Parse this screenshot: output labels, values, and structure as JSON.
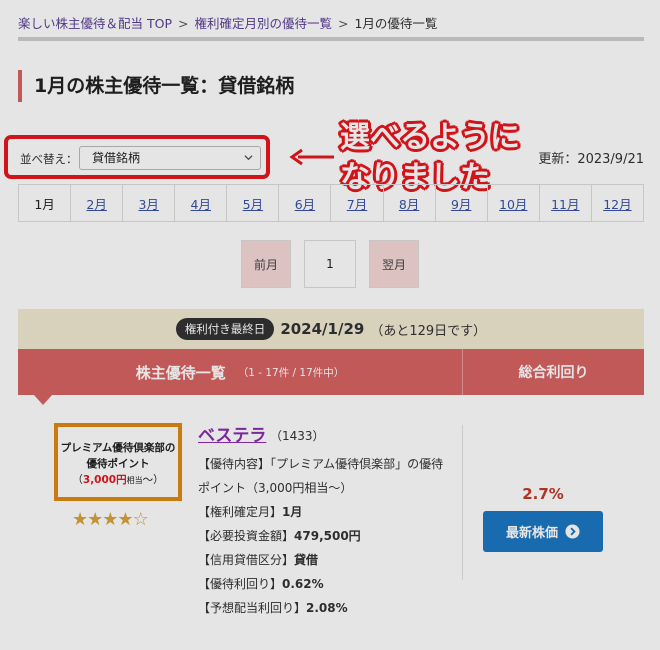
{
  "breadcrumb": {
    "items": [
      "楽しい株主優待＆配当 TOP",
      "権利確定月別の優待一覧",
      "1月の優待一覧"
    ],
    "separator": ">"
  },
  "page_title": "1月の株主優待一覧：貸借銘柄",
  "sort": {
    "label": "並べ替え：",
    "selected": "貸借銘柄"
  },
  "updated_text": "更新：2023/9/21",
  "callout": {
    "line1": "選べるように",
    "line2": "なりました",
    "color": "#e8171d"
  },
  "months": [
    "1月",
    "2月",
    "3月",
    "4月",
    "5月",
    "6月",
    "7月",
    "8月",
    "9月",
    "10月",
    "11月",
    "12月"
  ],
  "active_month": "1月",
  "pager": {
    "prev": "前月",
    "current": "1",
    "next": "翌月"
  },
  "rights_date": {
    "badge": "権利付き最終日",
    "date": "2024/1/29",
    "note": "（あと129日です）"
  },
  "list_header": {
    "title": "株主優待一覧",
    "count": "（1 - 17件 / 17件中）",
    "yield_label": "総合利回り"
  },
  "stock": {
    "thumb_line1": "プレミアム優待倶楽部の",
    "thumb_line2": "優待ポイント",
    "thumb_open": "（",
    "thumb_amount": "3,000円",
    "thumb_suffix": "相当",
    "thumb_close": "〜）",
    "rating": 4,
    "rating_max": 5,
    "name": "ベステラ",
    "code": "（1433）",
    "details": [
      {
        "label": "【優待内容】",
        "value": "「プレミアム優待倶楽部」の優待ポイント（3,000円相当〜）"
      },
      {
        "label": "【権利確定月】",
        "value": "1月"
      },
      {
        "label": "【必要投資金額】",
        "value": "479,500円"
      },
      {
        "label": "【信用貸借区分】",
        "value": "貸借"
      },
      {
        "label": "【優待利回り】",
        "value": "0.62%"
      },
      {
        "label": "【予想配当利回り】",
        "value": "2.08%"
      }
    ],
    "total_yield": "2.7%",
    "price_button": "最新株価"
  },
  "colors": {
    "accent": "#d86464",
    "thumb_border": "#e08a12",
    "button": "#1a78c2",
    "link": "#5a3f96"
  }
}
